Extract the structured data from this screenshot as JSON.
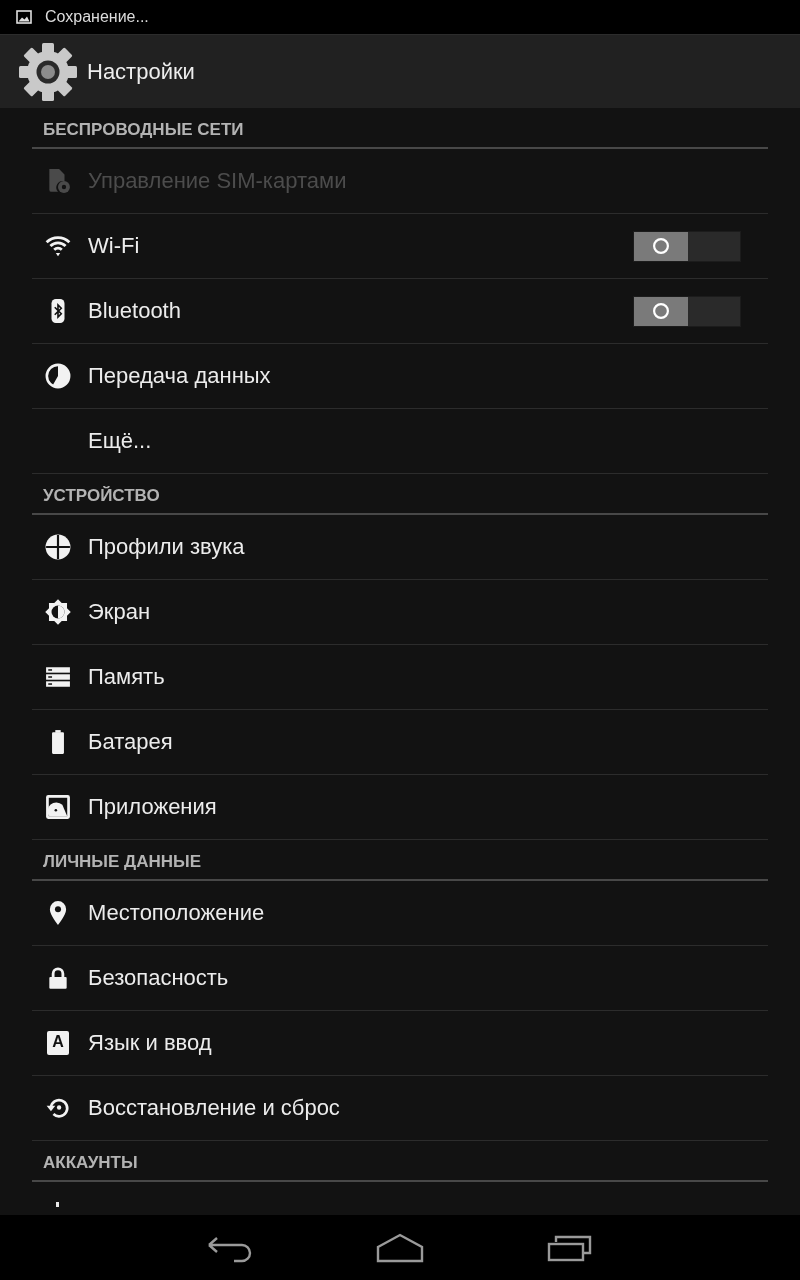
{
  "status_bar": {
    "notification": "Сохранение..."
  },
  "action_bar": {
    "title": "Настройки"
  },
  "sections": [
    {
      "title": "БЕСПРОВОДНЫЕ СЕТИ",
      "items": [
        {
          "label": "Управление SIM-картами",
          "kind": "link",
          "disabled": true
        },
        {
          "label": "Wi-Fi",
          "kind": "toggle",
          "disabled": false,
          "on": false
        },
        {
          "label": "Bluetooth",
          "kind": "toggle",
          "disabled": false,
          "on": false
        },
        {
          "label": "Передача данных",
          "kind": "link",
          "disabled": false
        },
        {
          "label": "Ещё...",
          "kind": "link",
          "disabled": false
        }
      ]
    },
    {
      "title": "УСТРОЙСТВО",
      "items": [
        {
          "label": "Профили звука",
          "kind": "link",
          "disabled": false
        },
        {
          "label": "Экран",
          "kind": "link",
          "disabled": false
        },
        {
          "label": "Память",
          "kind": "link",
          "disabled": false
        },
        {
          "label": "Батарея",
          "kind": "link",
          "disabled": false
        },
        {
          "label": "Приложения",
          "kind": "link",
          "disabled": false
        }
      ]
    },
    {
      "title": "ЛИЧНЫЕ ДАННЫЕ",
      "items": [
        {
          "label": "Местоположение",
          "kind": "link",
          "disabled": false
        },
        {
          "label": "Безопасность",
          "kind": "link",
          "disabled": false
        },
        {
          "label": "Язык и ввод",
          "kind": "link",
          "disabled": false,
          "icon_letter": "A"
        },
        {
          "label": "Восстановление и сброс",
          "kind": "link",
          "disabled": false
        }
      ]
    },
    {
      "title": "АККАУНТЫ"
    }
  ]
}
